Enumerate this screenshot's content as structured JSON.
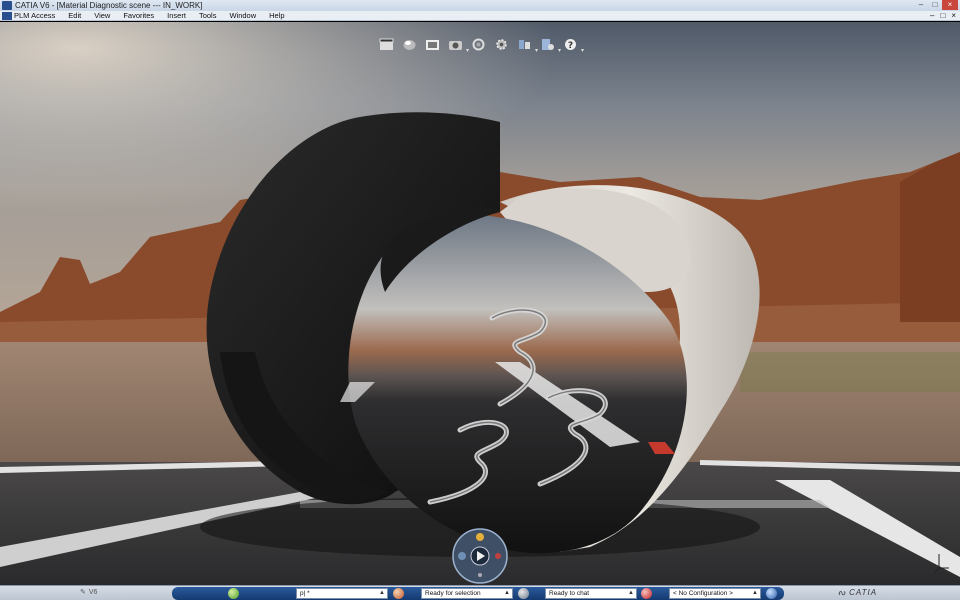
{
  "window": {
    "title": "CATIA V6 - [Material Diagnostic scene --- IN_WORK]",
    "controls": [
      "–",
      "□",
      "×"
    ]
  },
  "menubar": {
    "items": [
      "PLM Access",
      "Edit",
      "View",
      "Favorites",
      "Insert",
      "Tools",
      "Window",
      "Help"
    ],
    "doc_controls": [
      "–",
      "□",
      "×"
    ]
  },
  "toolbar": {
    "buttons": [
      {
        "icon": "clapperboard-icon"
      },
      {
        "icon": "material-sphere-icon"
      },
      {
        "icon": "render-image-icon"
      },
      {
        "icon": "camera-icon",
        "dropdown": true
      },
      {
        "icon": "rotate-view-icon"
      },
      {
        "icon": "gear-settings-icon"
      },
      {
        "icon": "light-bulbs-icon",
        "dropdown": true
      },
      {
        "icon": "environment-icon",
        "dropdown": true
      },
      {
        "icon": "help-icon",
        "dropdown": true
      }
    ]
  },
  "statusbar": {
    "v6_label": "V6",
    "command_input": "p| *",
    "selection_status": "Ready for selection",
    "chat_status": "Ready to chat",
    "configuration": "< No Configuration >",
    "brand": "CATIA"
  },
  "colors": {
    "sky_top": "#5d6775",
    "sky_mid": "#9aa1a8",
    "mesa": "#8a4a2c",
    "ground": "#8f7663",
    "asphalt": "#3a3a3c",
    "status_blue": "#1e4a85"
  }
}
